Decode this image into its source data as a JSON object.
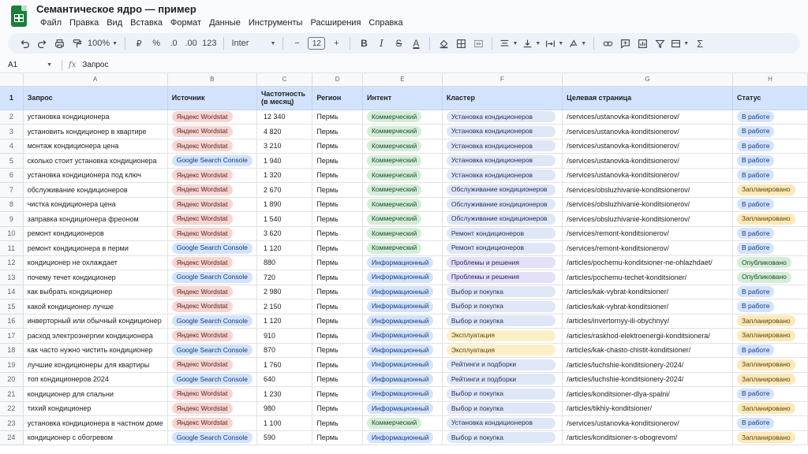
{
  "app": {
    "title": "Семантическое ядро — пример",
    "menu": [
      "Файл",
      "Правка",
      "Вид",
      "Вставка",
      "Формат",
      "Данные",
      "Инструменты",
      "Расширения",
      "Справка"
    ]
  },
  "toolbar": {
    "zoom": "100%",
    "currency": "₽",
    "percent": "%",
    "dec_dec": ".0",
    "inc_dec": ".00",
    "number_format": "123",
    "font": "Inter",
    "font_size": "12",
    "minus": "−",
    "plus": "+",
    "bold": "B",
    "italic": "I",
    "strike": "S",
    "text_color": "A",
    "sum": "Σ"
  },
  "formula": {
    "cell_ref": "A1",
    "fx": "fx",
    "value": "Запрос"
  },
  "columns": [
    "A",
    "B",
    "C",
    "D",
    "E",
    "F",
    "G",
    "H"
  ],
  "headers": [
    "Запрос",
    "Источник",
    "Частотность (в месяц)",
    "Регион",
    "Интент",
    "Кластер",
    "Целевая страница",
    "Статус"
  ],
  "rows": [
    {
      "n": "2",
      "query": "установка кондиционера",
      "source": "Яндекс Wordstat",
      "freq": "12 340",
      "region": "Пермь",
      "intent": "Коммерческий",
      "cluster": "Установка кондиционеров",
      "page": "/services/ustanovka-konditsionerov/",
      "status": "В работе"
    },
    {
      "n": "3",
      "query": "установить кондиционер в квартире",
      "source": "Яндекс Wordstat",
      "freq": "4 820",
      "region": "Пермь",
      "intent": "Коммерческий",
      "cluster": "Установка кондиционеров",
      "page": "/services/ustanovka-konditsionerov/",
      "status": "В работе"
    },
    {
      "n": "4",
      "query": "монтаж кондиционера цена",
      "source": "Яндекс Wordstat",
      "freq": "3 210",
      "region": "Пермь",
      "intent": "Коммерческий",
      "cluster": "Установка кондиционеров",
      "page": "/services/ustanovka-konditsionerov/",
      "status": "В работе"
    },
    {
      "n": "5",
      "query": "сколько стоит установка кондиционера",
      "source": "Google Search Console",
      "freq": "1 940",
      "region": "Пермь",
      "intent": "Коммерческий",
      "cluster": "Установка кондиционеров",
      "page": "/services/ustanovka-konditsionerov/",
      "status": "В работе"
    },
    {
      "n": "6",
      "query": "установка кондиционера под ключ",
      "source": "Яндекс Wordstat",
      "freq": "1 320",
      "region": "Пермь",
      "intent": "Коммерческий",
      "cluster": "Установка кондиционеров",
      "page": "/services/ustanovka-konditsionerov/",
      "status": "В работе"
    },
    {
      "n": "7",
      "query": "обслуживание кондиционеров",
      "source": "Яндекс Wordstat",
      "freq": "2 670",
      "region": "Пермь",
      "intent": "Коммерческий",
      "cluster": "Обслуживание кондиционеров",
      "page": "/services/obsluzhivanie-konditsionerov/",
      "status": "Запланировано"
    },
    {
      "n": "8",
      "query": "чистка кондиционера цена",
      "source": "Яндекс Wordstat",
      "freq": "1 890",
      "region": "Пермь",
      "intent": "Коммерческий",
      "cluster": "Обслуживание кондиционеров",
      "page": "/services/obsluzhivanie-konditsionerov/",
      "status": "В работе"
    },
    {
      "n": "9",
      "query": "заправка кондиционера фреоном",
      "source": "Яндекс Wordstat",
      "freq": "1 540",
      "region": "Пермь",
      "intent": "Коммерческий",
      "cluster": "Обслуживание кондиционеров",
      "page": "/services/obsluzhivanie-konditsionerov/",
      "status": "Запланировано"
    },
    {
      "n": "10",
      "query": "ремонт кондиционеров",
      "source": "Яндекс Wordstat",
      "freq": "3 620",
      "region": "Пермь",
      "intent": "Коммерческий",
      "cluster": "Ремонт кондиционеров",
      "page": "/services/remont-konditsionerov/",
      "status": "В работе"
    },
    {
      "n": "11",
      "query": "ремонт кондиционера в перми",
      "source": "Google Search Console",
      "freq": "1 120",
      "region": "Пермь",
      "intent": "Коммерческий",
      "cluster": "Ремонт кондиционеров",
      "page": "/services/remont-konditsionerov/",
      "status": "В работе"
    },
    {
      "n": "12",
      "query": "кондиционер не охлаждает",
      "source": "Яндекс Wordstat",
      "freq": "880",
      "region": "Пермь",
      "intent": "Информационный",
      "cluster": "Проблемы и решения",
      "page": "/articles/pochemu-konditsioner-ne-ohlazhdaet/",
      "status": "Опубликовано"
    },
    {
      "n": "13",
      "query": "почему течет кондиционер",
      "source": "Google Search Console",
      "freq": "720",
      "region": "Пермь",
      "intent": "Информационный",
      "cluster": "Проблемы и решения",
      "page": "/articles/pochemu-techet-konditsioner/",
      "status": "Опубликовано"
    },
    {
      "n": "14",
      "query": "как выбрать кондиционер",
      "source": "Яндекс Wordstat",
      "freq": "2 980",
      "region": "Пермь",
      "intent": "Информационный",
      "cluster": "Выбор и покупка",
      "page": "/articles/kak-vybrat-konditsioner/",
      "status": "В работе"
    },
    {
      "n": "15",
      "query": "какой кондиционер лучше",
      "source": "Яндекс Wordstat",
      "freq": "2 150",
      "region": "Пермь",
      "intent": "Информационный",
      "cluster": "Выбор и покупка",
      "page": "/articles/kak-vybrat-konditsioner/",
      "status": "В работе"
    },
    {
      "n": "16",
      "query": "инверторный или обычный кондиционер",
      "source": "Google Search Console",
      "freq": "1 120",
      "region": "Пермь",
      "intent": "Информационный",
      "cluster": "Выбор и покупка",
      "page": "/articles/invertornyy-ili-obychnyy/",
      "status": "Запланировано"
    },
    {
      "n": "17",
      "query": "расход электроэнергии кондиционера",
      "source": "Яндекс Wordstat",
      "freq": "910",
      "region": "Пермь",
      "intent": "Информационный",
      "cluster": "Эксплуатация",
      "page": "/articles/raskhod-elektroenergii-konditsionera/",
      "status": "Запланировано"
    },
    {
      "n": "18",
      "query": "как часто нужно чистить кондиционер",
      "source": "Google Search Console",
      "freq": "870",
      "region": "Пермь",
      "intent": "Информационный",
      "cluster": "Эксплуатация",
      "page": "/articles/kak-chasto-chistit-konditsioner/",
      "status": "В работе"
    },
    {
      "n": "19",
      "query": "лучшие кондиционеры для квартиры",
      "source": "Яндекс Wordstat",
      "freq": "1 760",
      "region": "Пермь",
      "intent": "Информационный",
      "cluster": "Рейтинги и подборки",
      "page": "/articles/luchshie-konditsionery-2024/",
      "status": "Запланировано"
    },
    {
      "n": "20",
      "query": "топ кондиционеров 2024",
      "source": "Google Search Console",
      "freq": "640",
      "region": "Пермь",
      "intent": "Информационный",
      "cluster": "Рейтинги и подборки",
      "page": "/articles/luchshie-konditsionery-2024/",
      "status": "Запланировано"
    },
    {
      "n": "21",
      "query": "кондиционер для спальни",
      "source": "Яндекс Wordstat",
      "freq": "1 230",
      "region": "Пермь",
      "intent": "Информационный",
      "cluster": "Выбор и покупка",
      "page": "/articles/konditsioner-dlya-spalni/",
      "status": "В работе"
    },
    {
      "n": "22",
      "query": "тихий кондиционер",
      "source": "Яндекс Wordstat",
      "freq": "980",
      "region": "Пермь",
      "intent": "Информационный",
      "cluster": "Выбор и покупка",
      "page": "/articles/tikhiy-konditsioner/",
      "status": "Запланировано"
    },
    {
      "n": "23",
      "query": "установка кондиционера в частном доме",
      "source": "Яндекс Wordstat",
      "freq": "1 100",
      "region": "Пермь",
      "intent": "Коммерческий",
      "cluster": "Установка кондиционеров",
      "page": "/services/ustanovka-konditsionerov/",
      "status": "В работе"
    },
    {
      "n": "24",
      "query": "кондиционер с обогревом",
      "source": "Google Search Console",
      "freq": "590",
      "region": "Пермь",
      "intent": "Информационный",
      "cluster": "Выбор и покупка",
      "page": "/articles/konditsioner-s-obogrevom/",
      "status": "Запланировано"
    }
  ],
  "colors": {
    "accent": "#188038",
    "header_fill": "#d3e3fd",
    "yandex_chip": "#f6d5d3",
    "google_chip": "#d3e3fd",
    "commercial_chip": "#d4edd9",
    "planned_chip": "#fce9b8"
  }
}
